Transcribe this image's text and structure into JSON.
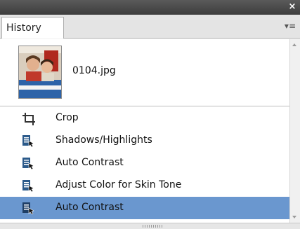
{
  "panel": {
    "tab_label": "History",
    "close_glyph": "×",
    "menu_glyph": "▾≡"
  },
  "snapshot": {
    "label": "0104.jpg",
    "icon": "photo-thumbnail"
  },
  "steps": [
    {
      "label": "Crop",
      "icon": "crop-icon",
      "selected": false
    },
    {
      "label": "Shadows/Highlights",
      "icon": "history-state-icon",
      "selected": false
    },
    {
      "label": "Auto Contrast",
      "icon": "history-state-icon",
      "selected": false
    },
    {
      "label": "Adjust Color for Skin Tone",
      "icon": "history-state-icon",
      "selected": false
    },
    {
      "label": "Auto Contrast",
      "icon": "history-state-icon",
      "selected": true
    }
  ],
  "colors": {
    "selected_row": "#6a97cf",
    "titlebar": "#4a4a4a"
  }
}
